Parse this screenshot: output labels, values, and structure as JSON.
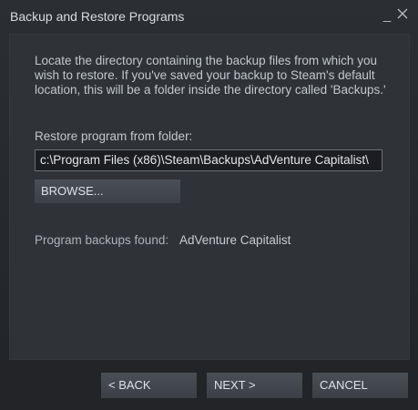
{
  "window": {
    "title": "Backup and Restore Programs",
    "minimize_glyph": "_",
    "close_icon": "close-icon"
  },
  "content": {
    "description": "Locate the directory containing the backup files from which you wish to restore. If you've saved your backup to Steam's default location, this will be a folder inside the directory called 'Backups.'",
    "folder_label": "Restore program from folder:",
    "folder_path": "c:\\Program Files (x86)\\Steam\\Backups\\AdVenture Capitalist\\",
    "browse_label": "BROWSE...",
    "found_label": "Program backups found:",
    "found_value": "AdVenture Capitalist"
  },
  "footer": {
    "back_label": "< BACK",
    "next_label": "NEXT >",
    "cancel_label": "CANCEL"
  },
  "colors": {
    "background": "#2b2e33",
    "panel": "#2f3236",
    "input_bg": "#1b1d20",
    "button": "#464b52",
    "text": "#c3c8cd"
  }
}
